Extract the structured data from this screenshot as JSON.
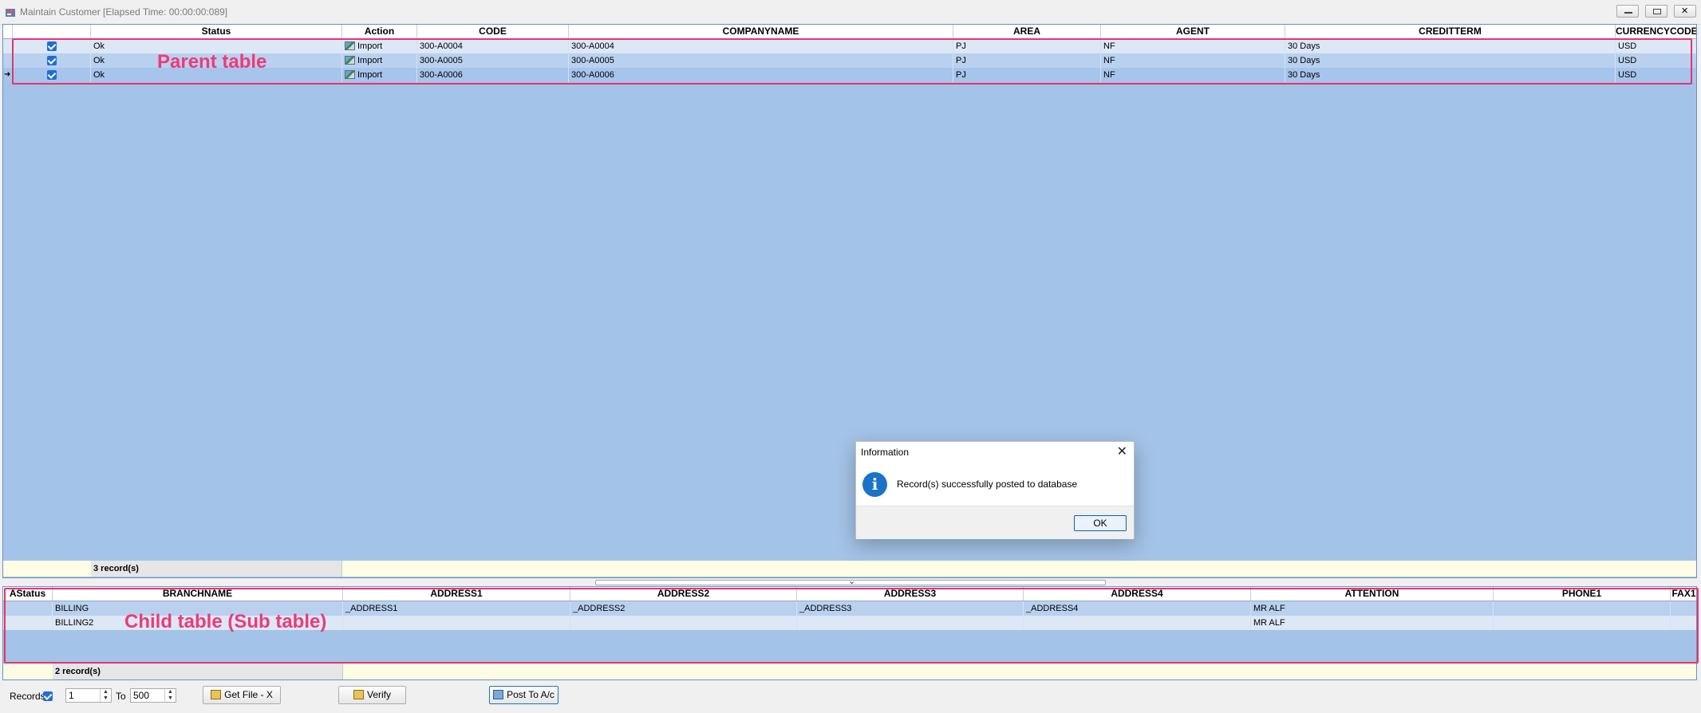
{
  "window": {
    "title": "Maintain Customer [Elapsed Time: 00:00:00:089]"
  },
  "parent_table": {
    "annotation": "Parent table",
    "columns": [
      "Status",
      "Action",
      "CODE",
      "COMPANYNAME",
      "AREA",
      "AGENT",
      "CREDITTERM",
      "CURRENCYCODE"
    ],
    "rows": [
      {
        "checked": true,
        "status": "Ok",
        "action": "Import",
        "code": "300-A0004",
        "companyname": "300-A0004",
        "area": "PJ",
        "agent": "NF",
        "creditterm": "30 Days",
        "currencycode": "USD"
      },
      {
        "checked": true,
        "status": "Ok",
        "action": "Import",
        "code": "300-A0005",
        "companyname": "300-A0005",
        "area": "PJ",
        "agent": "NF",
        "creditterm": "30 Days",
        "currencycode": "USD"
      },
      {
        "checked": true,
        "status": "Ok",
        "action": "Import",
        "code": "300-A0006",
        "companyname": "300-A0006",
        "area": "PJ",
        "agent": "NF",
        "creditterm": "30 Days",
        "currencycode": "USD"
      }
    ],
    "record_count": "3 record(s)"
  },
  "child_table": {
    "annotation": "Child table (Sub table)",
    "columns": [
      "AStatus",
      "BRANCHNAME",
      "ADDRESS1",
      "ADDRESS2",
      "ADDRESS3",
      "ADDRESS4",
      "ATTENTION",
      "PHONE1",
      "FAX1"
    ],
    "rows": [
      {
        "astatus": "",
        "branchname": "BILLING",
        "address1": "_ADDRESS1",
        "address2": "_ADDRESS2",
        "address3": "_ADDRESS3",
        "address4": "_ADDRESS4",
        "attention": "MR ALF",
        "phone1": "",
        "fax1": ""
      },
      {
        "astatus": "",
        "branchname": "BILLING2",
        "address1": "",
        "address2": "",
        "address3": "",
        "address4": "",
        "attention": "MR ALF",
        "phone1": "",
        "fax1": ""
      }
    ],
    "record_count": "2 record(s)"
  },
  "dialog": {
    "title": "Information",
    "message": "Record(s) successfully posted to database",
    "ok_label": "OK",
    "close_glyph": "✕",
    "info_glyph": "i"
  },
  "bottombar": {
    "records_label": "Records",
    "records_checked": true,
    "from_value": "1",
    "to_label": "To",
    "to_value": "500",
    "get_file_label": "Get File - X",
    "verify_label": "Verify",
    "post_label": "Post To A/c"
  },
  "colors": {
    "grid_background": "#a4c3e8",
    "annotation": "#e8336d",
    "checkbox": "#1f6fd1"
  }
}
